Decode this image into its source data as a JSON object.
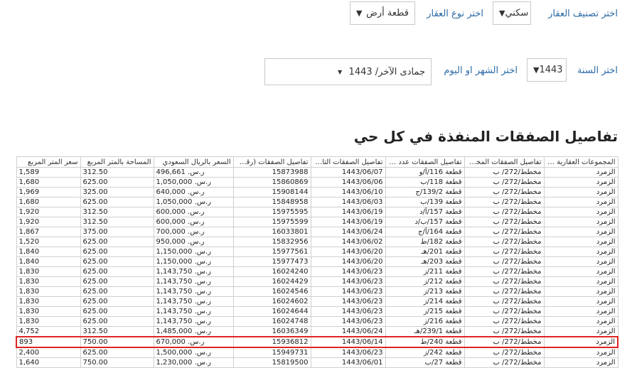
{
  "filters": {
    "classification_label": "اختر تصنيف العقار",
    "classification_value": "سكني",
    "type_label": "اختر نوع العقار",
    "type_value": "قطعة أرض",
    "year_label": "اختر السنة",
    "year_value": "1443",
    "month_label": "اختر الشهر او اليوم",
    "month_value": "جمادى الآخر/ 1443"
  },
  "section_title": "تفاصيل الصفقات المنفذة في كل حي",
  "table": {
    "columns": [
      "المجموعات العقارية ا...",
      "تفاصيل الصفقات المخطط",
      "تفاصيل الصفقات عدد ا...",
      "تفاصيل الصفقات التار...",
      "تفاصيل الصفقات (رقم...",
      "السعر بالريال السعودي",
      "المساحة بالمتر المربع",
      "سعر المتر المربع"
    ],
    "rows": [
      [
        "الزمرد",
        "مخطط/272/ ب",
        "قطعة 116/أ/و",
        "1443/06/07",
        "15873988",
        "ر.س. 496,661",
        "312.50",
        "1,589"
      ],
      [
        "الزمرد",
        "مخطط/272/ ب",
        "قطعة 118/ب",
        "1443/06/06",
        "15860869",
        "ر.س. 1,050,000",
        "625.00",
        "1,680"
      ],
      [
        "الزمرد",
        "مخطط/272/ ب",
        "قطعة 139/2/ج",
        "1443/06/10",
        "15908144",
        "ر.س. 640,000",
        "325.00",
        "1,969"
      ],
      [
        "الزمرد",
        "مخطط/272/ ب",
        "قطعة 139/ب",
        "1443/06/03",
        "15848958",
        "ر.س. 1,050,000",
        "625.00",
        "1,680"
      ],
      [
        "الزمرد",
        "مخطط/272/ ب",
        "قطعة 157/أ/د",
        "1443/06/19",
        "15975595",
        "ر.س. 600,000",
        "312.50",
        "1,920"
      ],
      [
        "الزمرد",
        "مخطط/272/ ب",
        "قطعة 157/ب/د",
        "1443/06/19",
        "15975599",
        "ر.س. 600,000",
        "312.50",
        "1,920"
      ],
      [
        "الزمرد",
        "مخطط/272/ ب",
        "قطعة 164/أ/ج",
        "1443/06/24",
        "16033801",
        "ر.س. 700,000",
        "375.00",
        "1,867"
      ],
      [
        "الزمرد",
        "مخطط/272/ ب",
        "قطعة 182/ط",
        "1443/06/02",
        "15832956",
        "ر.س. 950,000",
        "625.00",
        "1,520"
      ],
      [
        "الزمرد",
        "مخطط/272/ ب",
        "قطعة 201/هـ",
        "1443/06/20",
        "15977561",
        "ر.س. 1,150,000",
        "625.00",
        "1,840"
      ],
      [
        "الزمرد",
        "مخطط/272/ ب",
        "قطعة 203/هـ",
        "1443/06/20",
        "15977473",
        "ر.س. 1,150,000",
        "625.00",
        "1,840"
      ],
      [
        "الزمرد",
        "مخطط/272/ ب",
        "قطعة 211/ز",
        "1443/06/23",
        "16024240",
        "ر.س. 1,143,750",
        "625.00",
        "1,830"
      ],
      [
        "الزمرد",
        "مخطط/272/ ب",
        "قطعة 212/ز",
        "1443/06/23",
        "16024429",
        "ر.س. 1,143,750",
        "625.00",
        "1,830"
      ],
      [
        "الزمرد",
        "مخطط/272/ ب",
        "قطعة 213/ز",
        "1443/06/23",
        "16024546",
        "ر.س. 1,143,750",
        "625.00",
        "1,830"
      ],
      [
        "الزمرد",
        "مخطط/272/ ب",
        "قطعة 214/ز",
        "1443/06/23",
        "16024602",
        "ر.س. 1,143,750",
        "625.00",
        "1,830"
      ],
      [
        "الزمرد",
        "مخطط/272/ ب",
        "قطعة 215/ز",
        "1443/06/23",
        "16024644",
        "ر.س. 1,143,750",
        "625.00",
        "1,830"
      ],
      [
        "الزمرد",
        "مخطط/272/ ب",
        "قطعة 216/ز",
        "1443/06/23",
        "16024748",
        "ر.س. 1,143,750",
        "625.00",
        "1,830"
      ],
      [
        "الزمرد",
        "مخطط/272/ ب",
        "قطعة 239/1/هـ",
        "1443/06/24",
        "16036349",
        "ر.س. 1,485,000",
        "312.50",
        "4,752"
      ],
      [
        "الزمرد",
        "مخطط/272/ ب",
        "قطعة 240/ط",
        "1443/06/14",
        "15936812",
        "ر.س. 670,000",
        "750.00",
        "893"
      ],
      [
        "الزمرد",
        "مخطط/272/ ب",
        "قطعة 242/ز",
        "1443/06/23",
        "15949731",
        "ر.س. 1,500,000",
        "625.00",
        "2,400"
      ],
      [
        "الزمرد",
        "مخطط/272/ ب",
        "قطعة 27/ب",
        "1443/06/01",
        "15819500",
        "ر.س. 1,230,000",
        "750.00",
        "1,640"
      ]
    ],
    "highlighted_row": 17
  },
  "colors": {
    "label": "#2c6aa5",
    "highlight": "#e02424"
  },
  "icons": {
    "dropdown": "chevron-down-icon",
    "dropdown_small": "caret-down-icon"
  }
}
